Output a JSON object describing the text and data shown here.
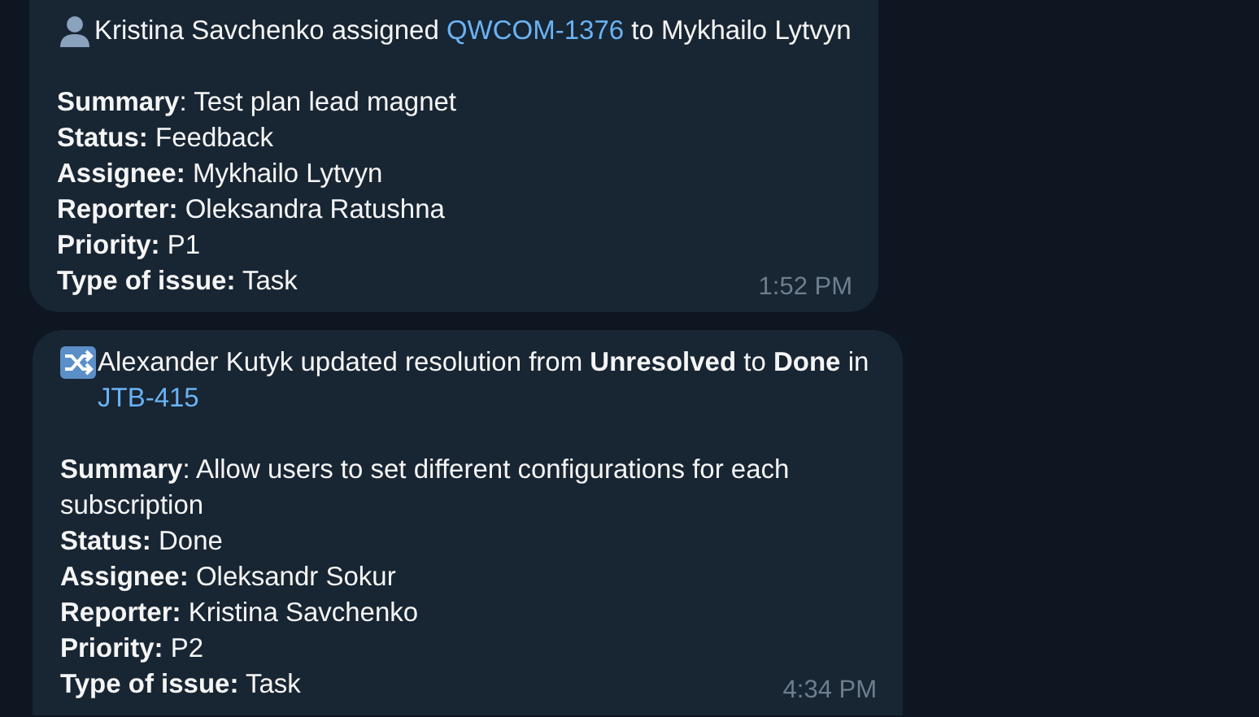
{
  "messages": [
    {
      "kind": "person",
      "heading": [
        {
          "kind": "plain",
          "text": "Kristina Savchenko assigned "
        },
        {
          "kind": "link",
          "text": "QWCOM-1376"
        },
        {
          "kind": "plain",
          "text": " to Mykhailo Lytvyn"
        }
      ],
      "fields": [
        "**Summary**: Test plan lead magnet",
        "**Status:** Feedback",
        "**Assignee:** Mykhailo Lytvyn",
        "**Reporter:** Oleksandra Ratushna",
        "**Priority:** P1",
        "**Type of issue:** Task"
      ],
      "time": "1:52 PM"
    },
    {
      "kind": "shuffle",
      "heading": [
        {
          "kind": "plain",
          "text": "Alexander Kutyk updated resolution from "
        },
        {
          "kind": "bold",
          "text": "Unresolved"
        },
        {
          "kind": "plain",
          "text": " to "
        },
        {
          "kind": "bold",
          "text": "Done"
        },
        {
          "kind": "plain",
          "text": " in "
        },
        {
          "kind": "link",
          "text": "JTB-415"
        }
      ],
      "fields": [
        "**Summary**: Allow users to set different configurations for each subscription",
        "**Status:** Done",
        "**Assignee:** Oleksandr Sokur",
        "**Reporter:** Kristina Savchenko",
        "**Priority:** P2",
        "**Type of issue:** Task"
      ],
      "time": "4:34 PM"
    }
  ]
}
